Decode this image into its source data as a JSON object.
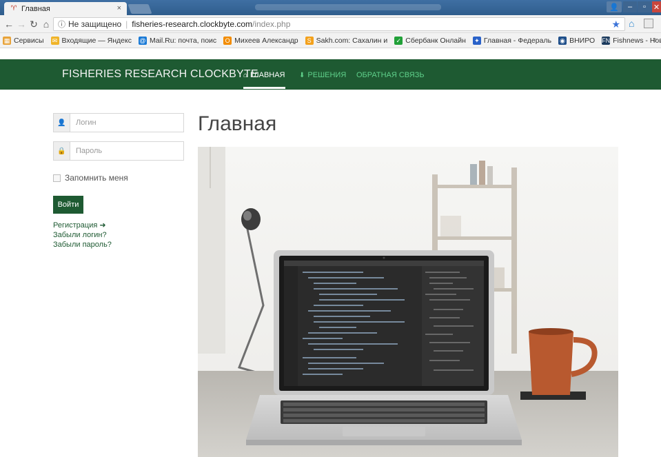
{
  "browser": {
    "tab_title": "Главная",
    "tab_close": "×",
    "address": {
      "security_label": "Не защищено",
      "host": "fisheries-research.clockbyte.com",
      "path": "/index.php"
    },
    "bookmarks": [
      {
        "label": "Сервисы",
        "color": "#e8a33a",
        "icon": "apps-icon"
      },
      {
        "label": "Входящие — Яндекс",
        "color": "#f0b429",
        "icon": "mail-icon"
      },
      {
        "label": "Mail.Ru: почта, поис",
        "color": "#1a7ad6",
        "icon": "mailru-icon"
      },
      {
        "label": "Михеев Александр",
        "color": "#f28c00",
        "icon": "ok-icon"
      },
      {
        "label": "Sakh.com: Сахалин и",
        "color": "#f3a11c",
        "icon": "sakh-icon"
      },
      {
        "label": "Сбербанк Онлайн",
        "color": "#21a038",
        "icon": "sber-icon"
      },
      {
        "label": "Главная - Федераль",
        "color": "#2a62c9",
        "icon": "gov-icon"
      },
      {
        "label": "ВНИРО",
        "color": "#1f4f8a",
        "icon": "vniro-icon"
      },
      {
        "label": "Fishnews - Новости",
        "color": "#1c3b5e",
        "icon": "fishnews-icon"
      }
    ],
    "bookmarks_more": "»"
  },
  "site": {
    "brand": "FISHERIES RESEARCH CLOCKBYTE",
    "nav": [
      {
        "label": "ГЛАВНАЯ",
        "icon": "home-icon",
        "active": true
      },
      {
        "label": "РЕШЕНИЯ",
        "icon": "download-icon",
        "active": false
      },
      {
        "label": "ОБРАТНАЯ СВЯЗЬ",
        "icon": "",
        "active": false
      }
    ],
    "colors": {
      "brand_green": "#1e5a32",
      "link_green": "#5fd08a"
    }
  },
  "login": {
    "login_placeholder": "Логин",
    "password_placeholder": "Пароль",
    "remember_label": "Запомнить меня",
    "submit_label": "Войти",
    "register_link": "Регистрация",
    "forgot_login_link": "Забыли логин?",
    "forgot_password_link": "Забыли пароль?"
  },
  "main": {
    "title": "Главная"
  }
}
